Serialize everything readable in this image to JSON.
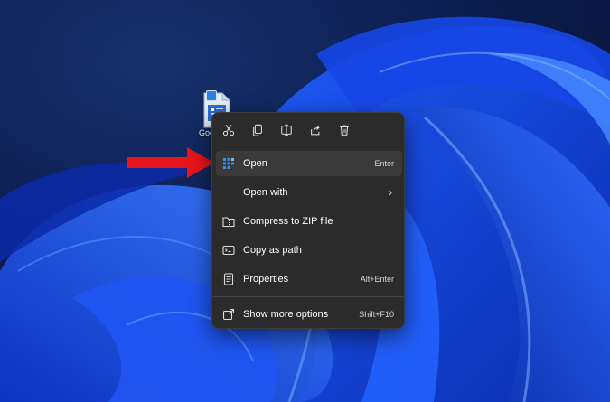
{
  "desktop": {
    "icon_label": "Goo",
    "file_icon": "document-file-icon"
  },
  "context_menu": {
    "toolbar": [
      {
        "name": "cut-icon"
      },
      {
        "name": "copy-icon"
      },
      {
        "name": "rename-icon"
      },
      {
        "name": "share-icon"
      },
      {
        "name": "delete-icon"
      }
    ],
    "items": [
      {
        "label": "Open",
        "shortcut": "Enter",
        "icon": "open-app-icon"
      },
      {
        "label": "Open with",
        "shortcut": "",
        "icon": "",
        "submenu": true
      },
      {
        "label": "Compress to ZIP file",
        "shortcut": "",
        "icon": "zip-folder-icon"
      },
      {
        "label": "Copy as path",
        "shortcut": "",
        "icon": "copy-path-icon"
      },
      {
        "label": "Properties",
        "shortcut": "Alt+Enter",
        "icon": "properties-icon"
      },
      {
        "label": "Show more options",
        "shortcut": "Shift+F10",
        "icon": "more-options-icon"
      }
    ],
    "chevron": "›"
  },
  "colors": {
    "menu_bg": "#2b2b2b",
    "highlight": "#3a3a3a",
    "arrow": "#e8141b",
    "accent": "#3a8ee6"
  }
}
